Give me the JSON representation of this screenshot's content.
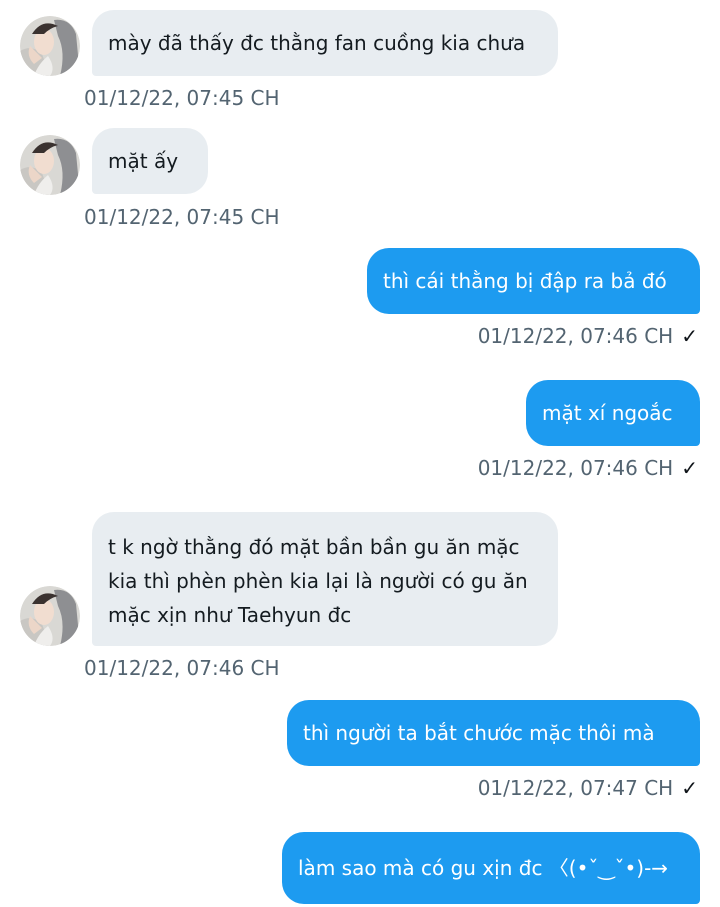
{
  "messages": [
    {
      "direction": "incoming",
      "text": "mày đã thấy đc thằng fan cuồng kia chưa",
      "timestamp": "01/12/22,  07:45 CH"
    },
    {
      "direction": "incoming",
      "text": "mặt ấy",
      "timestamp": "01/12/22,  07:45 CH"
    },
    {
      "direction": "outgoing",
      "text": "thì cái thằng bị đập ra bả đó",
      "timestamp": "01/12/22,  07:46 CH",
      "status_icon": "check-icon"
    },
    {
      "direction": "outgoing",
      "text": "mặt xí ngoắc",
      "timestamp": "01/12/22,  07:46 CH",
      "status_icon": "check-icon"
    },
    {
      "direction": "incoming",
      "lines": [
        "t k ngờ thằng đó mặt bần bần gu ăn mặc",
        "kia thì phèn phèn kia lại là người có gu ăn",
        "mặc xịn như Taehyun đc"
      ],
      "timestamp": "01/12/22,  07:46 CH"
    },
    {
      "direction": "outgoing",
      "text": "thì người ta bắt chước mặc thôi mà",
      "timestamp": "01/12/22,  07:47 CH",
      "status_icon": "check-icon"
    },
    {
      "direction": "outgoing",
      "text": "làm sao mà có gu xịn đc  〈(•ˇ‿ˇ•)-→"
    }
  ],
  "colors": {
    "incoming_bubble": "#e8edf1",
    "outgoing_bubble": "#1d9bf0",
    "timestamp_text": "#536471"
  },
  "icons": {
    "sent_status": "check-icon",
    "avatar": "avatar-photo"
  },
  "status_glyph": "✓"
}
